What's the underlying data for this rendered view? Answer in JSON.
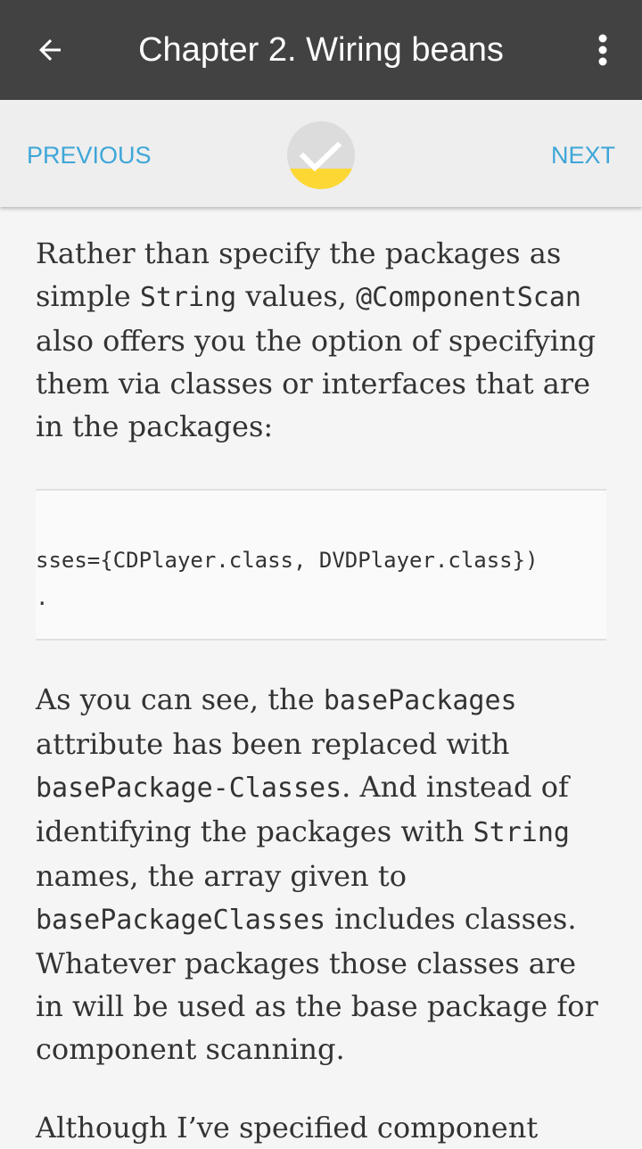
{
  "appbar": {
    "title": "Chapter 2. Wiring beans"
  },
  "navbar": {
    "previous_label": "PREVIOUS",
    "next_label": "NEXT",
    "progress_fraction": 0.3,
    "accent_color": "#3ea6d8",
    "progress_color": "#fdd835"
  },
  "content": {
    "p1": {
      "t1": "Rather than specify the packages as simple ",
      "c1": "String",
      "t2": " values, ",
      "c2": "@ComponentScan",
      "t3": " also offers you the option of specifying them via classes or interfaces that are in the packages:"
    },
    "code": {
      "line1": "sses={CDPlayer.class, DVDPlayer.class})",
      "line2": "."
    },
    "p2": {
      "t1": "As you can see, the ",
      "c1": "basePackages",
      "t2": " attribute has been replaced with ",
      "c2": "basePackage-Classes",
      "t3": ". And instead of identifying the packages with ",
      "c3": "String",
      "t4": " names, the array given to ",
      "c4": "basePackageClasses",
      "t5": " includes classes. Whatever packages those classes are in will be used as the base package for component scanning."
    },
    "p3": {
      "t1": "Although I’ve specified component"
    }
  }
}
